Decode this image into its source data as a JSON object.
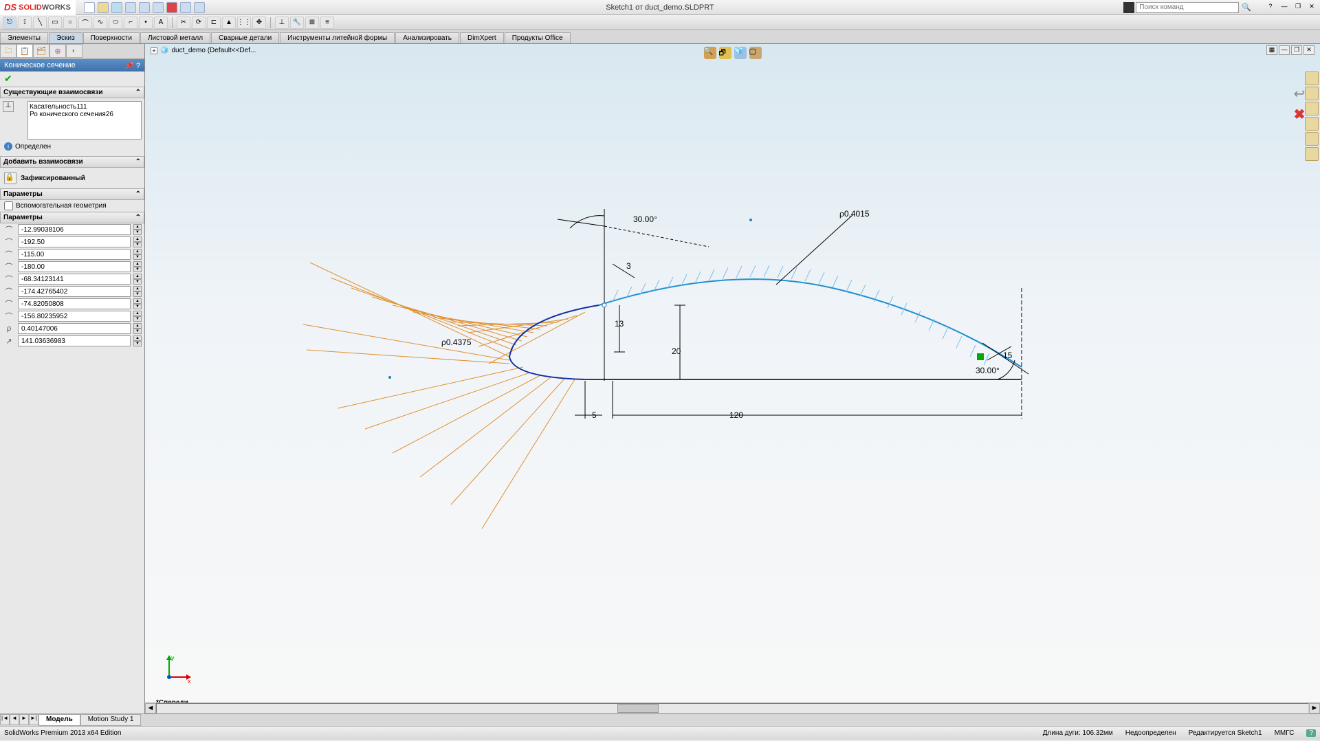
{
  "title": "Sketch1 от duct_demo.SLDPRT",
  "logo": {
    "ds": "DS",
    "sw1": "SOLID",
    "sw2": "WORKS"
  },
  "search_placeholder": "Поиск команд",
  "tabs": [
    "Элементы",
    "Эскиз",
    "Поверхности",
    "Листовой металл",
    "Сварные детали",
    "Инструменты литейной формы",
    "Анализировать",
    "DimXpert",
    "Продукты Office"
  ],
  "active_tab": 1,
  "panel": {
    "title": "Коническое сечение",
    "sec_existing": "Существующие взаимосвязи",
    "relations": [
      "Касательность111",
      "Ро конического сечения26"
    ],
    "status": "Определен",
    "sec_add": "Добавить взаимосвязи",
    "fix_label": "Зафиксированный",
    "sec_options": "Параметры",
    "aux_geom": "Вспомогательная геометрия",
    "sec_params": "Параметры",
    "params": [
      {
        "icon": "⌒",
        "val": "-12.99038106"
      },
      {
        "icon": "⌒",
        "val": "-192.50"
      },
      {
        "icon": "⌒",
        "val": "-115.00"
      },
      {
        "icon": "⌒",
        "val": "-180.00"
      },
      {
        "icon": "⌒",
        "val": "-68.34123141"
      },
      {
        "icon": "⌒",
        "val": "-174.42765402"
      },
      {
        "icon": "⌒",
        "val": "-74.82050808"
      },
      {
        "icon": "⌒",
        "val": "-156.80235952"
      },
      {
        "icon": "ρ",
        "val": "0.40147006"
      },
      {
        "icon": "↗",
        "val": "141.03636983"
      }
    ]
  },
  "tree_head": "duct_demo  (Default<<Def...",
  "dimensions": {
    "angle1": "30.00°",
    "rho2": "ρ0.4015",
    "d3": "3",
    "rho1": "ρ0.4375",
    "d13": "13",
    "d20": "20",
    "d15": "15",
    "angle2": "30.00°",
    "d5": "5",
    "d120": "120"
  },
  "view_label": "*Спереди",
  "triad": {
    "x": "x",
    "y": "y"
  },
  "bottom_tabs": [
    "Модель",
    "Motion Study 1"
  ],
  "status_bar": {
    "left": "SolidWorks Premium 2013 x64 Edition",
    "arc": "Длина дуги: 106.32мм",
    "def": "Недоопределен",
    "edit": "Редактируется Sketch1",
    "units": "ММГС"
  }
}
